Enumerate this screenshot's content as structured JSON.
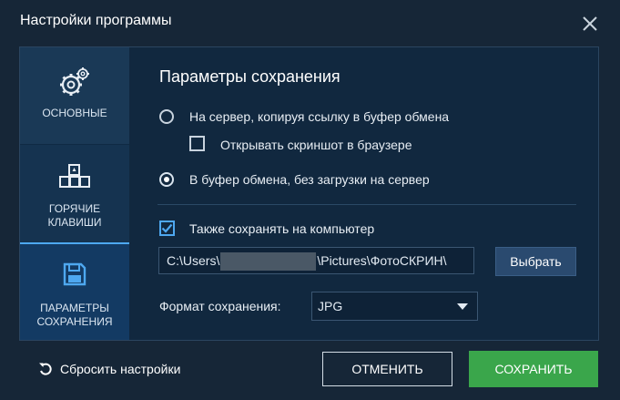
{
  "window": {
    "title": "Настройки программы",
    "close_icon": "close-icon"
  },
  "sidebar": {
    "items": [
      {
        "label": "ОСНОВНЫЕ",
        "icon": "gears-icon",
        "selected": false
      },
      {
        "label_line1": "ГОРЯЧИЕ",
        "label_line2": "КЛАВИШИ",
        "icon": "keyboard-keys-icon",
        "selected": false
      },
      {
        "label_line1": "ПАРАМЕТРЫ",
        "label_line2": "СОХРАНЕНИЯ",
        "icon": "floppy-disk-icon",
        "selected": true
      }
    ]
  },
  "main": {
    "section_title": "Параметры сохранения",
    "options": {
      "server_label": "На сервер, копируя ссылку в буфер обмена",
      "server_selected": false,
      "open_browser_label": "Открывать скриншот в браузере",
      "open_browser_checked": false,
      "clipboard_label": "В буфер обмена, без загрузки на сервер",
      "clipboard_selected": true,
      "save_to_pc_label": "Также сохранять на компьютер",
      "save_to_pc_checked": true
    },
    "path": {
      "prefix": "C:\\Users\\",
      "suffix": "\\Pictures\\ФотоСКРИН\\"
    },
    "choose_button": "Выбрать",
    "format_label": "Формат сохранения:",
    "format_value": "JPG"
  },
  "footer": {
    "reset_label": "Сбросить настройки",
    "cancel_label": "ОТМЕНИТЬ",
    "save_label": "СОХРАНИТЬ"
  },
  "colors": {
    "accent": "#4ea8f0",
    "save_green": "#3aa64b",
    "background": "#162637"
  }
}
